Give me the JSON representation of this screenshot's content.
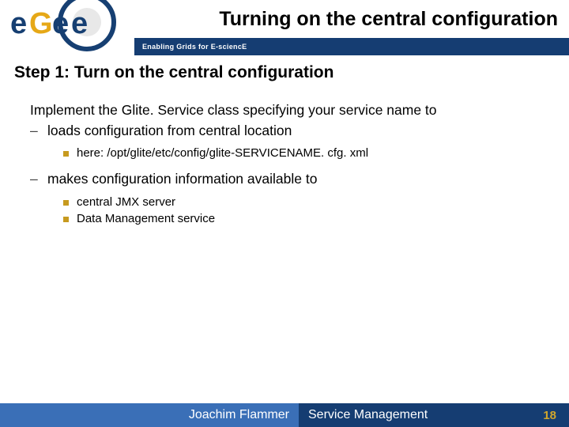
{
  "header": {
    "tagline": "Enabling Grids for E-sciencE",
    "title": "Turning on the central configuration",
    "logo_letters": [
      "e",
      "G",
      "e",
      "e"
    ]
  },
  "content": {
    "step_title": "Step 1: Turn on the central configuration",
    "intro": "Implement the Glite. Service class specifying your service name to",
    "dash1": "loads configuration from central location",
    "sq1": "here: /opt/glite/etc/config/glite-SERVICENAME. cfg. xml",
    "dash2": "makes configuration information available to",
    "sq2": "central JMX server",
    "sq3": "Data Management service"
  },
  "footer": {
    "author": "Joachim Flammer",
    "subject": "Service Management",
    "page": "18"
  }
}
